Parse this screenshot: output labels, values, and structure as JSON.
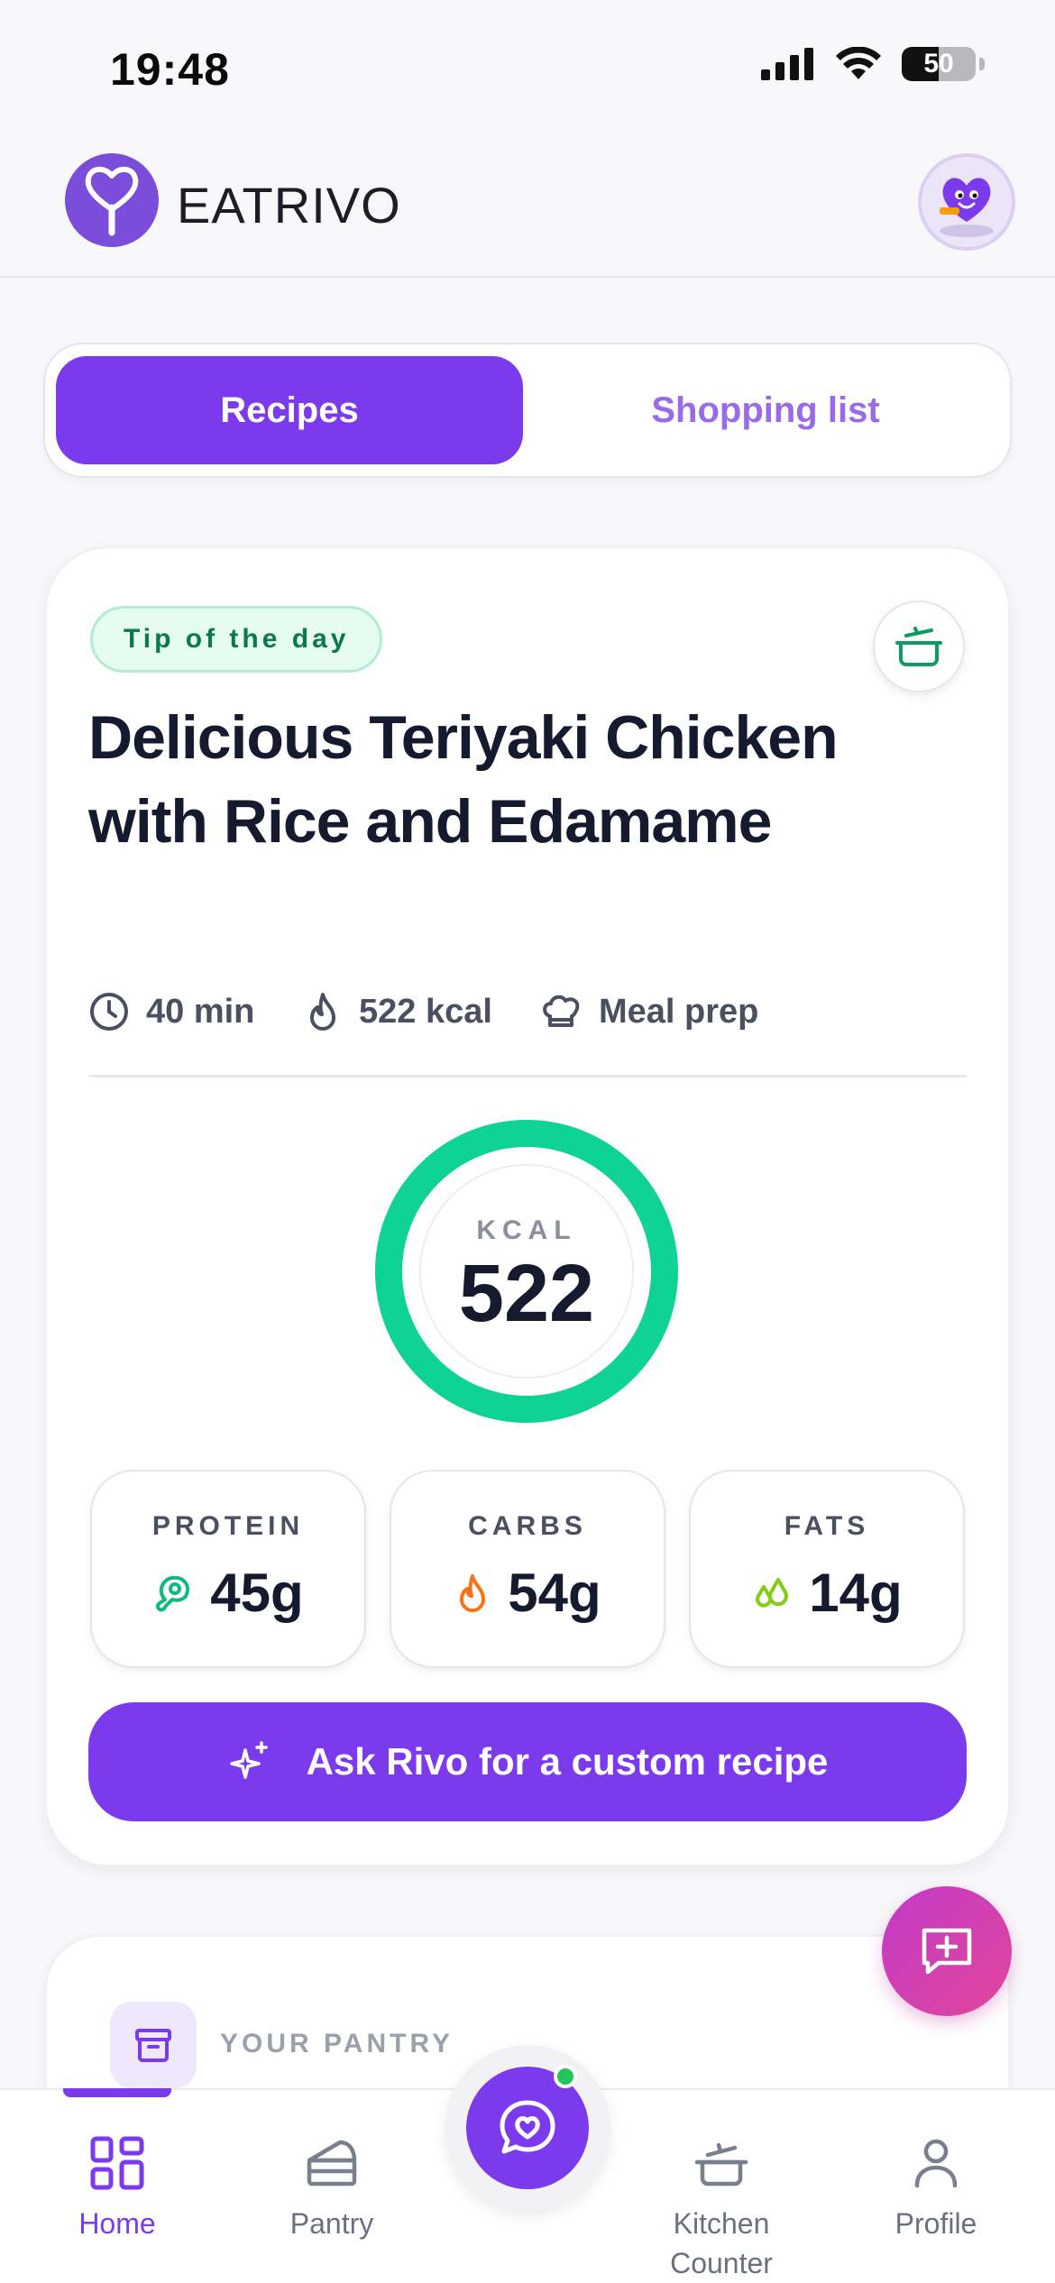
{
  "status_bar": {
    "time": "19:48",
    "battery": "50",
    "battery_level": 0.5
  },
  "header": {
    "brand": "EATRIVO"
  },
  "tabs": [
    {
      "label": "Recipes",
      "active": true
    },
    {
      "label": "Shopping list",
      "active": false
    }
  ],
  "recipe_card": {
    "badge": "Tip of the day",
    "title": "Delicious Teriyaki Chicken with Rice and Edamame",
    "meta": {
      "time": "40 min",
      "kcal": "522 kcal",
      "category": "Meal prep"
    },
    "ring": {
      "label": "KCAL",
      "value": "522",
      "progress": 1.0
    },
    "macros": [
      {
        "label": "PROTEIN",
        "value": "45g",
        "icon": "meat-icon",
        "color": "#10b981"
      },
      {
        "label": "CARBS",
        "value": "54g",
        "icon": "flame-icon",
        "color": "#f97316"
      },
      {
        "label": "FATS",
        "value": "14g",
        "icon": "droplets-icon",
        "color": "#84cc16"
      }
    ],
    "cta": "Ask Rivo for a custom recipe"
  },
  "pantry_card": {
    "label": "YOUR PANTRY"
  },
  "bottom_nav": [
    {
      "label": "Home",
      "icon": "grid-icon",
      "active": true
    },
    {
      "label": "Pantry",
      "icon": "cake-icon",
      "active": false
    },
    {
      "label": "Kitchen Counter",
      "icon": "cooking-pot-icon",
      "active": false
    },
    {
      "label": "Profile",
      "icon": "user-icon",
      "active": false
    }
  ],
  "colors": {
    "primary": "#7c3aed",
    "ring": "#0fd394",
    "fab_gradient_start": "#c13ac8",
    "fab_gradient_end": "#e2479a"
  }
}
